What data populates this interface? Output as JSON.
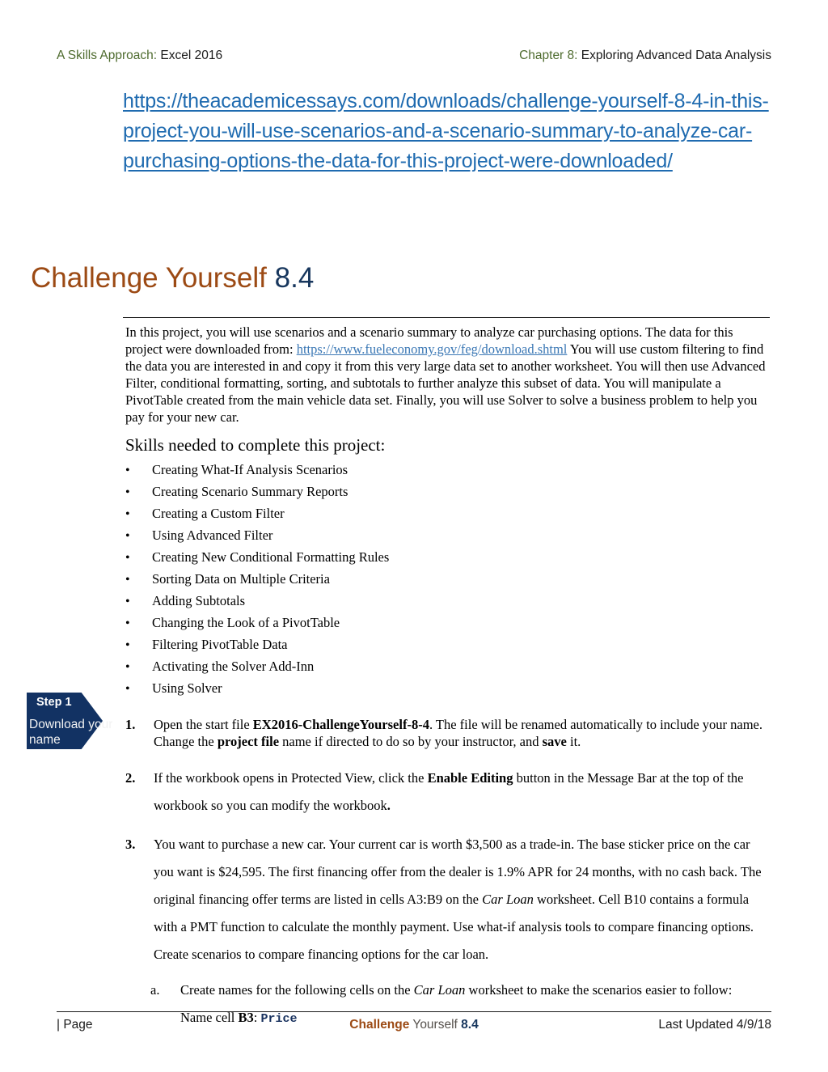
{
  "header": {
    "left_green": "A Skills Approach:",
    "left_dark": " Excel 2016",
    "right_green": "Chapter 8:",
    "right_dark": " Exploring Advanced Data Analysis"
  },
  "url_heading": {
    "text": "https://theacademicessays.com/downloads/challenge-yourself-8-4-in-this-project-you-will-use-scenarios-and-a-scenario-summary-to-analyze-car-purchasing-options-the-data-for-this-project-were-downloaded/",
    "color": "#1f6bb0"
  },
  "title": {
    "main": "Challenge Yourself ",
    "number": "8.4",
    "main_color": "#9c4a14",
    "number_color": "#17365d"
  },
  "intro": {
    "part1": "In this project, you will use scenarios and a scenario summary to analyze car purchasing options. The data for this project were downloaded from: ",
    "link": "https://www.fueleconomy.gov/feg/download.shtml",
    "part2": " You will use custom filtering to find the data you are interested in and copy it from this very large data set to another worksheet. You will then use Advanced Filter, conditional formatting, sorting, and subtotals to further analyze this subset of data. You will manipulate a PivotTable created from the main vehicle data set. Finally, you will use Solver to solve a business problem to help you pay for your new car."
  },
  "skills": {
    "heading": "Skills needed to complete this project:",
    "bullet_glyph": "•",
    "items": [
      "Creating What-If Analysis Scenarios",
      "Creating Scenario Summary Reports",
      "Creating a Custom Filter",
      "Using Advanced Filter",
      "Creating New Conditional Formatting Rules",
      "Sorting Data on Multiple Criteria",
      "Adding Subtotals",
      "Changing the Look of a PivotTable",
      "Filtering PivotTable Data",
      "Activating the Solver Add-Inn",
      "Using Solver"
    ]
  },
  "step_badge": {
    "title": "Step 1",
    "subtitle": "Download your name",
    "color": "#123263"
  },
  "steps": [
    {
      "num": "1.",
      "seg1": "Open the start file ",
      "bold1": "EX2016-ChallengeYourself-8-4",
      "seg2": ". The file will be renamed automatically to include your name. Change the ",
      "bold2": "project file",
      "seg3": " name if directed to do so by your instructor, and ",
      "bold3": "save",
      "seg4": " it."
    },
    {
      "num": "2.",
      "seg1": "If the workbook opens in Protected View, click the ",
      "bold1": "Enable Editing",
      "seg2": " button in the Message Bar at the top of the workbook so you can modify the workbook",
      "bold2": ".",
      "seg3": "",
      "bold3": "",
      "seg4": ""
    },
    {
      "num": "3.",
      "seg1": "You want to purchase a new car. Your current car is worth $3,500 as a trade-in. The base sticker price on the car you want is $24,595. The first financing offer from the dealer is 1.9% APR for 24 months, with no cash back. The original financing offer terms are listed in cells A3:B9 on the ",
      "italic1": "Car Loan",
      "seg2": " worksheet. Cell B10 contains a formula with a PMT function to calculate the monthly payment. Use what-if analysis tools to compare financing options. Create scenarios to compare financing options for the car loan."
    }
  ],
  "substeps": [
    {
      "letter": "a.",
      "seg1": "Create names for the following cells on the ",
      "italic1": "Car Loan",
      "seg2": " worksheet to make the scenarios easier to follow:"
    }
  ],
  "name_cell_line": {
    "prefix": "Name cell ",
    "cell": "B3",
    "colon": ": ",
    "value": "Price"
  },
  "footer": {
    "left": "| Page",
    "center_brown": "Challenge",
    "center_gray": " Yourself ",
    "center_navy": "8.4",
    "right": "Last Updated 4/9/18"
  }
}
